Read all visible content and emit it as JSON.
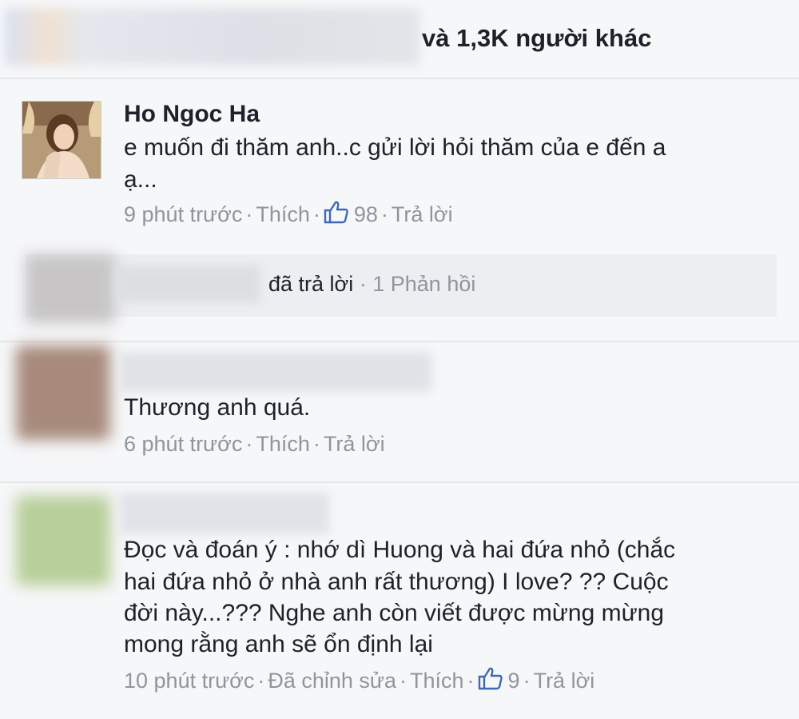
{
  "likes": {
    "text": "và 1,3K người khác"
  },
  "comments": [
    {
      "author": "Ho Ngoc Ha",
      "text_line1": "e muốn đi thăm anh..c gửi lời hỏi thăm của e đến a",
      "text_line2": "ạ...",
      "time": "9 phút trước",
      "like_label": "Thích",
      "like_count": "98",
      "reply_label": "Trả lời"
    },
    {
      "text": "Thương anh quá.",
      "time": "6 phút trước",
      "like_label": "Thích",
      "reply_label": "Trả lời"
    },
    {
      "lines": [
        "Đọc và đoán ý : nhớ dì Huong và hai đứa nhỏ (chắc",
        "hai đứa nhỏ ở nhà anh rất thương) I love? ?? Cuộc",
        "đời này...??? Nghe anh còn viết được  mừng mừng",
        "mong rằng anh sẽ ổn định lại"
      ],
      "time": "10 phút trước",
      "edited_label": "Đã chỉnh sửa",
      "like_label": "Thích",
      "like_count": "9",
      "reply_label": "Trả lời"
    }
  ],
  "reply_summary": {
    "replied_label": "đã trả lời",
    "count_label": "1 Phản hồi"
  },
  "colors": {
    "text": "#1d2129",
    "meta": "#90949c",
    "like_icon": "#4267b2",
    "background": "#f6f7f9"
  },
  "icons": [
    "thumbs-up-icon",
    "avatar"
  ]
}
